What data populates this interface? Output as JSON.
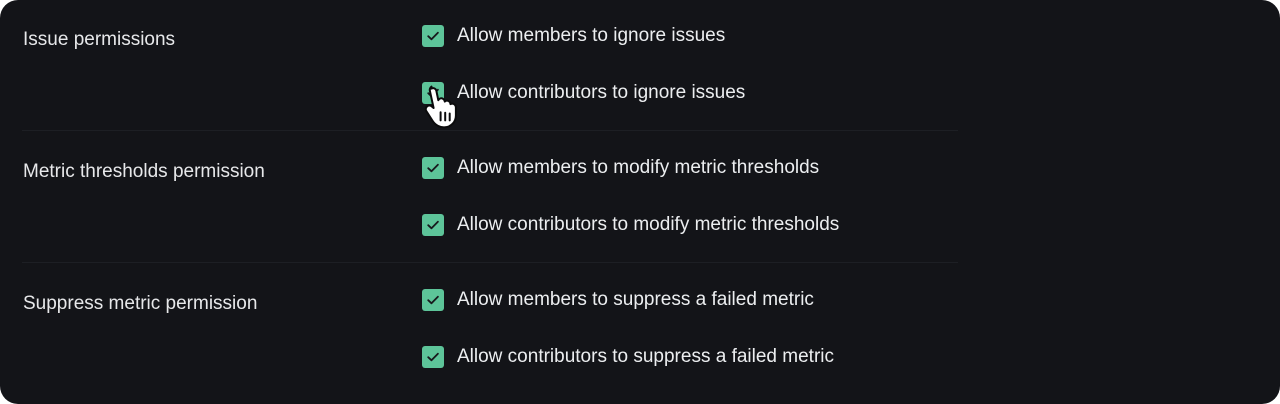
{
  "sections": [
    {
      "label": "Issue permissions",
      "options": [
        {
          "label": "Allow members to ignore issues",
          "checked": true
        },
        {
          "label": "Allow contributors to ignore issues",
          "checked": true
        }
      ]
    },
    {
      "label": "Metric thresholds permission",
      "options": [
        {
          "label": "Allow members to modify metric thresholds",
          "checked": true
        },
        {
          "label": "Allow contributors to modify metric thresholds",
          "checked": true
        }
      ]
    },
    {
      "label": "Suppress metric permission",
      "options": [
        {
          "label": "Allow members to suppress a failed metric",
          "checked": true
        },
        {
          "label": "Allow contributors to suppress a failed metric",
          "checked": true
        }
      ]
    }
  ],
  "colors": {
    "background": "#131418",
    "checkbox": "#5dc499",
    "text": "#eceef0",
    "divider": "#1d1f24"
  },
  "icons": {
    "checkbox_mark": "check-icon",
    "cursor": "hand-pointer-cursor-icon"
  }
}
